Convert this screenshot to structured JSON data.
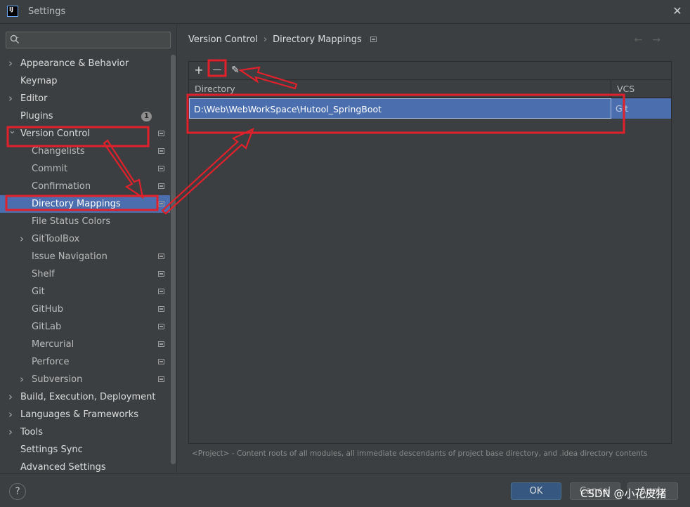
{
  "window": {
    "title": "Settings",
    "close_glyph": "✕"
  },
  "search": {
    "placeholder": "",
    "icon": "search-icon"
  },
  "sidebar": {
    "items": [
      {
        "label": "Appearance & Behavior",
        "level": 0,
        "expandable": true,
        "expanded": false
      },
      {
        "label": "Keymap",
        "level": 0,
        "expandable": false
      },
      {
        "label": "Editor",
        "level": 0,
        "expandable": true,
        "expanded": false
      },
      {
        "label": "Plugins",
        "level": 0,
        "expandable": false,
        "badge": "1"
      },
      {
        "label": "Version Control",
        "level": 0,
        "expandable": true,
        "expanded": true,
        "project_icon": true
      },
      {
        "label": "Changelists",
        "level": 1,
        "project_icon": true
      },
      {
        "label": "Commit",
        "level": 1,
        "project_icon": true
      },
      {
        "label": "Confirmation",
        "level": 1,
        "project_icon": true
      },
      {
        "label": "Directory Mappings",
        "level": 1,
        "project_icon": true,
        "selected": true
      },
      {
        "label": "File Status Colors",
        "level": 1
      },
      {
        "label": "GitToolBox",
        "level": 1,
        "expandable": true,
        "expanded": false
      },
      {
        "label": "Issue Navigation",
        "level": 1,
        "project_icon": true
      },
      {
        "label": "Shelf",
        "level": 1,
        "project_icon": true
      },
      {
        "label": "Git",
        "level": 1,
        "project_icon": true
      },
      {
        "label": "GitHub",
        "level": 1,
        "project_icon": true
      },
      {
        "label": "GitLab",
        "level": 1,
        "project_icon": true
      },
      {
        "label": "Mercurial",
        "level": 1,
        "project_icon": true
      },
      {
        "label": "Perforce",
        "level": 1,
        "project_icon": true
      },
      {
        "label": "Subversion",
        "level": 1,
        "expandable": true,
        "expanded": false,
        "project_icon": true
      },
      {
        "label": "Build, Execution, Deployment",
        "level": 0,
        "expandable": true,
        "expanded": false
      },
      {
        "label": "Languages & Frameworks",
        "level": 0,
        "expandable": true,
        "expanded": false
      },
      {
        "label": "Tools",
        "level": 0,
        "expandable": true,
        "expanded": false
      },
      {
        "label": "Settings Sync",
        "level": 0
      },
      {
        "label": "Advanced Settings",
        "level": 0
      }
    ]
  },
  "breadcrumb": {
    "parent": "Version Control",
    "separator": "›",
    "current": "Directory Mappings"
  },
  "nav": {
    "back": "←",
    "forward": "→"
  },
  "toolbar": {
    "add": "+",
    "remove": "—",
    "edit": "✎"
  },
  "table": {
    "columns": [
      "Directory",
      "VCS"
    ],
    "rows": [
      {
        "directory": "D:\\Web\\WebWorkSpace\\Hutool_SpringBoot",
        "vcs": "Git"
      }
    ]
  },
  "hint": "<Project> - Content roots of all modules, all immediate descendants of project base directory, and .idea directory contents",
  "footer": {
    "help": "?",
    "ok": "OK",
    "cancel": "Cancel",
    "apply": "Apply"
  },
  "watermark": "CSDN @小花皮猪",
  "colors": {
    "selection": "#4b6eaf",
    "annotation": "#e0202a",
    "background": "#3c3f41"
  }
}
